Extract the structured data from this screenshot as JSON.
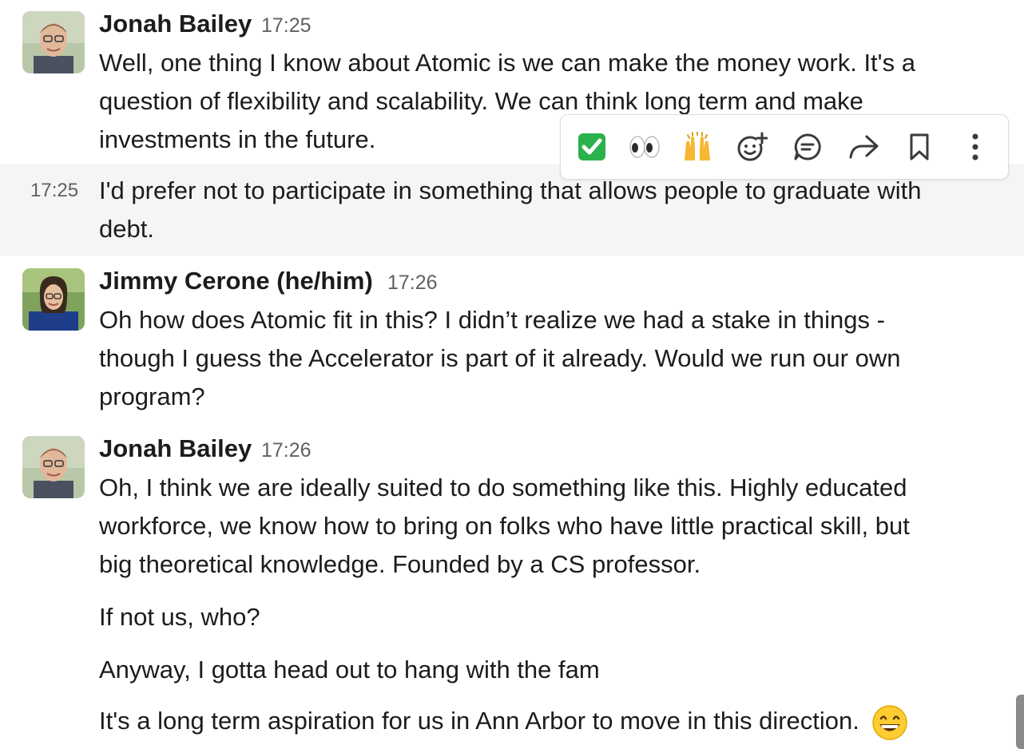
{
  "hover_time": "17:25",
  "toolbar": {
    "items": [
      {
        "icon": "white-check-mark-emoji",
        "glyph": "✅"
      },
      {
        "icon": "eyes-emoji",
        "glyph": "👀"
      },
      {
        "icon": "raised-hands-emoji",
        "glyph": "🙌"
      },
      {
        "icon": "add-reaction-icon"
      },
      {
        "icon": "reply-in-thread-icon"
      },
      {
        "icon": "forward-icon"
      },
      {
        "icon": "bookmark-icon"
      },
      {
        "icon": "more-actions-icon"
      }
    ]
  },
  "messages": [
    {
      "author": "Jonah Bailey",
      "time": "17:25",
      "lines": [
        "Well, one thing I know about Atomic is we can make the money work. It's a",
        "question of flexibility and scalability. We can think long term and make",
        "investments in the future."
      ],
      "continuation": {
        "time": "17:25",
        "lines": [
          "I'd prefer not to participate in something that allows people to graduate with",
          "debt."
        ]
      }
    },
    {
      "author": "Jimmy Cerone (he/him)",
      "time": "17:26",
      "lines": [
        "Oh how does Atomic fit in this? I didn’t realize we had a stake in things -",
        "though I guess the Accelerator is part of it already. Would we run our own",
        "program?"
      ]
    },
    {
      "author": "Jonah Bailey",
      "time": "17:26",
      "lines": [
        "Oh, I think we are ideally suited to do something like this. Highly educated",
        "workforce, we know how to bring on folks who have little practical skill, but",
        "big theoretical knowledge. Founded by a CS professor."
      ],
      "followups": [
        "If not us, who?",
        "Anyway, I gotta head out to hang with the fam",
        "It's a long term aspiration for us in Ann Arbor to move in this direction."
      ],
      "trailing_emoji": "grinning-smile-emoji"
    }
  ]
}
